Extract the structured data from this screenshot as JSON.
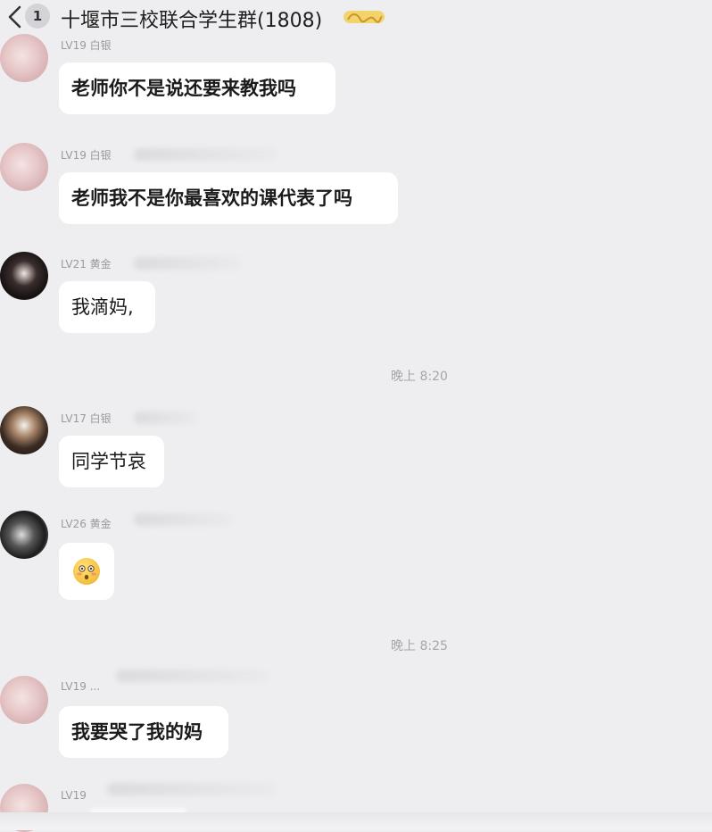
{
  "header": {
    "back_icon": "chevron-left-icon",
    "unread_count": "1",
    "title": "十堰市三校联合学生群(1808)"
  },
  "messages": [
    {
      "level": "LV19 白银",
      "text": "老师你不是说还要来教我吗"
    },
    {
      "level": "LV19 白银",
      "text": "老师我不是你最喜欢的课代表了吗"
    },
    {
      "level": "LV21 黄金",
      "text": "我滴妈,"
    },
    {
      "level": "LV17 白银",
      "text": "同学节哀"
    },
    {
      "level": "LV26 黄金",
      "emoji": "flushed-face"
    },
    {
      "level": "LV19 ...",
      "text": "我要哭了我的妈"
    },
    {
      "level": "LV19"
    }
  ],
  "timestamps": [
    "晚上 8:20",
    "晚上 8:25"
  ]
}
